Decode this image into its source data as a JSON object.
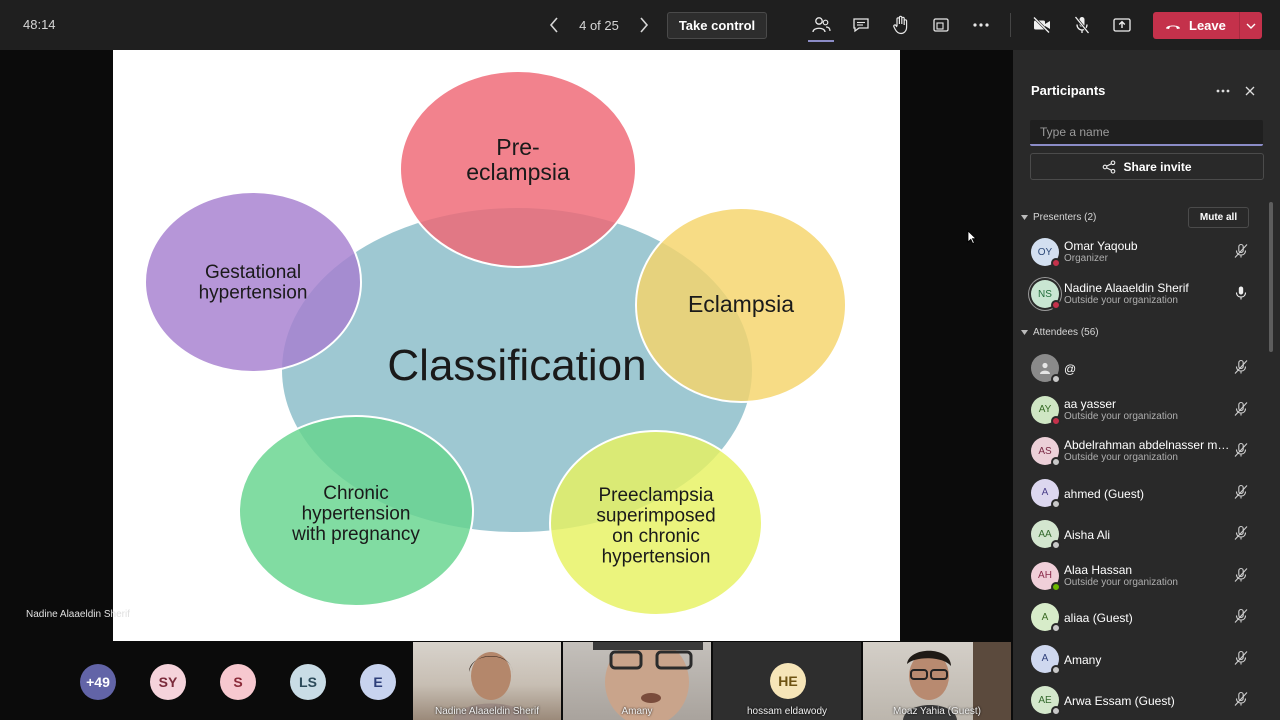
{
  "toolbar": {
    "timer": "48:14",
    "slide_counter": "4 of 25",
    "take_control_label": "Take control",
    "leave_label": "Leave",
    "icons": [
      "people-icon",
      "chat-icon",
      "raise-hand-icon",
      "rooms-icon",
      "more-icon",
      "camera-off-icon",
      "mic-off-icon",
      "share-tray-icon",
      "phone-icon"
    ],
    "leave_color": "#c4314b",
    "accent_color": "#8b8cc7"
  },
  "slide": {
    "center_label": "Classification",
    "bubbles": [
      {
        "id": "preeclampsia",
        "lines": [
          "Pre-",
          "eclampsia"
        ],
        "color": "#ef6674"
      },
      {
        "id": "eclampsia",
        "lines": [
          "Eclampsia"
        ],
        "color": "#f5d46a"
      },
      {
        "id": "gestational",
        "lines": [
          "Gestational",
          "hypertension"
        ],
        "color": "#a67fd0"
      },
      {
        "id": "chronic",
        "lines": [
          "Chronic",
          "hypertension",
          "with pregnancy"
        ],
        "color": "#65d48d"
      },
      {
        "id": "superimposed",
        "lines": [
          "Preeclampsia",
          "superimposed",
          "on chronic",
          "hypertension"
        ],
        "color": "#e7f260"
      }
    ],
    "center_color": "#9ec8d2",
    "presenter_name": "Nadine Alaaeldin Sherif"
  },
  "strip": {
    "chips": [
      {
        "label": "+49",
        "bg": "#6264a7",
        "fg": "#ffffff"
      },
      {
        "label": "SY",
        "bg": "#f5d3db",
        "fg": "#7a2a3a"
      },
      {
        "label": "S",
        "bg": "#f7c8cf",
        "fg": "#8a2a38"
      },
      {
        "label": "LS",
        "bg": "#c9dce6",
        "fg": "#2c4a5a"
      },
      {
        "label": "E",
        "bg": "#c8d3ef",
        "fg": "#2e3f7a"
      }
    ],
    "tiles": [
      {
        "name": "Nadine Alaaeldin Sherif"
      },
      {
        "name": "Amany"
      },
      {
        "name": "hossam eldawody",
        "initials": "HE"
      },
      {
        "name": "Moaz Yahia (Guest)"
      }
    ]
  },
  "panel": {
    "title": "Participants",
    "search_placeholder": "Type a name",
    "share_label": "Share invite",
    "presenters_label": "Presenters (2)",
    "mute_all_label": "Mute all",
    "attendees_label": "Attendees (56)",
    "presenters": [
      {
        "initials": "OY",
        "name": "Omar Yaqoub",
        "sub": "Organizer",
        "avatar_bg": "#d3dff0",
        "avatar_fg": "#2e4a7a",
        "status": "#c4314b",
        "mic": "mic-off-icon"
      },
      {
        "initials": "NS",
        "name": "Nadine Alaaeldin Sherif",
        "sub": "Outside your organization",
        "avatar_bg": "#c9e6d2",
        "avatar_fg": "#226e3c",
        "status": "#c4314b",
        "mic": "mic-on-icon"
      }
    ],
    "attendees": [
      {
        "initials": "",
        "name": "@",
        "sub": "",
        "avatar_bg": "#8a8a8a",
        "avatar_fg": "#ffffff",
        "status": "#c8c8c8"
      },
      {
        "initials": "AY",
        "name": "aa yasser",
        "sub": "Outside your organization",
        "avatar_bg": "#cfe6c4",
        "avatar_fg": "#356a24",
        "status": "#c4314b"
      },
      {
        "initials": "AS",
        "name": "Abdelrahman abdelnasser mo...",
        "sub": "Outside your organization",
        "avatar_bg": "#ecd0d8",
        "avatar_fg": "#7a2a44",
        "status": "#c8c8c8"
      },
      {
        "initials": "A",
        "name": "ahmed (Guest)",
        "sub": "",
        "avatar_bg": "#dcd7ef",
        "avatar_fg": "#4a3f8a",
        "status": "#c8c8c8"
      },
      {
        "initials": "AA",
        "name": "Aisha Ali",
        "sub": "",
        "avatar_bg": "#d3e6cf",
        "avatar_fg": "#356a2e",
        "status": "#c8c8c8"
      },
      {
        "initials": "AH",
        "name": "Alaa Hassan",
        "sub": "Outside your organization",
        "avatar_bg": "#f0cfd9",
        "avatar_fg": "#8a2a4a",
        "status": "#6bb700"
      },
      {
        "initials": "A",
        "name": "aliaa (Guest)",
        "sub": "",
        "avatar_bg": "#d7ecc9",
        "avatar_fg": "#3a6a24",
        "status": "#c8c8c8"
      },
      {
        "initials": "A",
        "name": "Amany",
        "sub": "",
        "avatar_bg": "#cfd8ef",
        "avatar_fg": "#2e3f7a",
        "status": "#c8c8c8"
      },
      {
        "initials": "AE",
        "name": "Arwa Essam (Guest)",
        "sub": "",
        "avatar_bg": "#d4e8cc",
        "avatar_fg": "#356a2e",
        "status": "#c8c8c8"
      }
    ]
  }
}
